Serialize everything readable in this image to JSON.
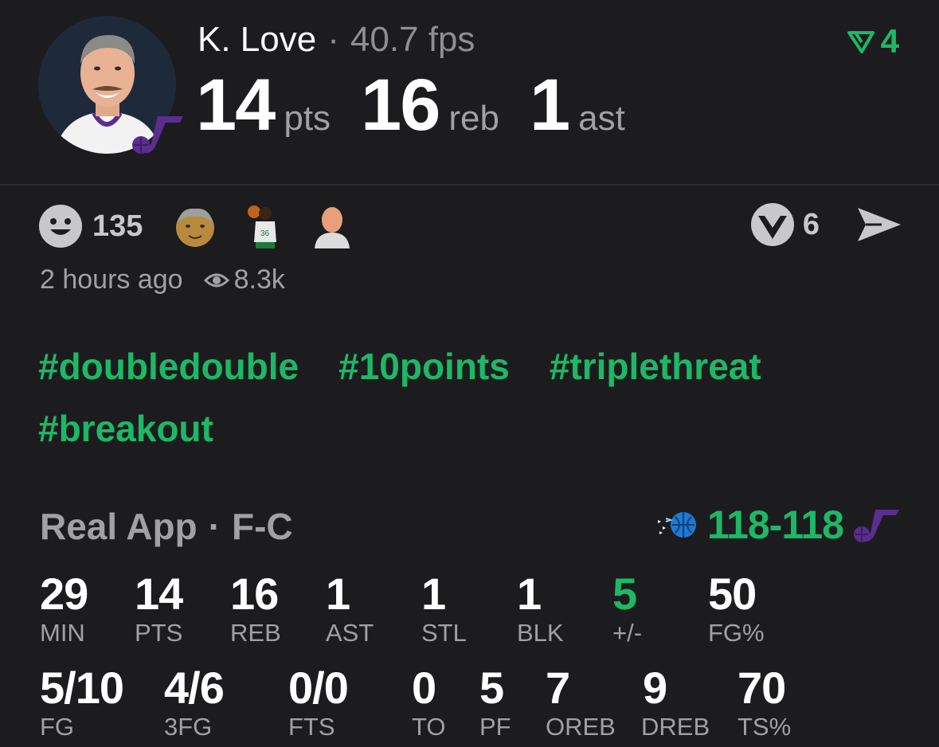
{
  "header": {
    "player_name": "K. Love",
    "separator": "·",
    "fps": "40.7 fps",
    "stats": [
      {
        "value": "14",
        "unit": "pts"
      },
      {
        "value": "16",
        "unit": "reb"
      },
      {
        "value": "1",
        "unit": "ast"
      }
    ],
    "badge_count": "4",
    "team_logo": "jazz-note-logo"
  },
  "reactions": {
    "smiley_count": "135",
    "reactor_thumbnails": [
      "old-man-face-avatar",
      "celtics-player-avatar",
      "bald-figure-avatar"
    ],
    "vote_count": "6"
  },
  "meta": {
    "time_ago": "2 hours ago",
    "views": "8.3k"
  },
  "hashtags": [
    "#doubledouble",
    "#10points",
    "#triplethreat",
    "#breakout"
  ],
  "game": {
    "app": "Real App",
    "separator": "·",
    "position": "F-C",
    "score": "118-118",
    "home_logo": "magic-logo",
    "away_logo": "jazz-note-logo"
  },
  "box_row1": [
    {
      "value": "29",
      "label": "MIN"
    },
    {
      "value": "14",
      "label": "PTS"
    },
    {
      "value": "16",
      "label": "REB"
    },
    {
      "value": "1",
      "label": "AST"
    },
    {
      "value": "1",
      "label": "STL"
    },
    {
      "value": "1",
      "label": "BLK"
    },
    {
      "value": "5",
      "label": "+/-"
    },
    {
      "value": "50",
      "label": "FG%"
    }
  ],
  "box_row2": [
    {
      "value": "5/10",
      "label": "FG"
    },
    {
      "value": "4/6",
      "label": "3FG"
    },
    {
      "value": "0/0",
      "label": "FTS"
    },
    {
      "value": "0",
      "label": "TO"
    },
    {
      "value": "5",
      "label": "PF"
    },
    {
      "value": "7",
      "label": "OREB"
    },
    {
      "value": "9",
      "label": "DREB"
    },
    {
      "value": "70",
      "label": "TS%"
    }
  ],
  "colors": {
    "background": "#1c1c1e",
    "accent_green": "#1db866",
    "muted_text": "#a0a0a5",
    "jazz_purple": "#5b2d8e"
  }
}
